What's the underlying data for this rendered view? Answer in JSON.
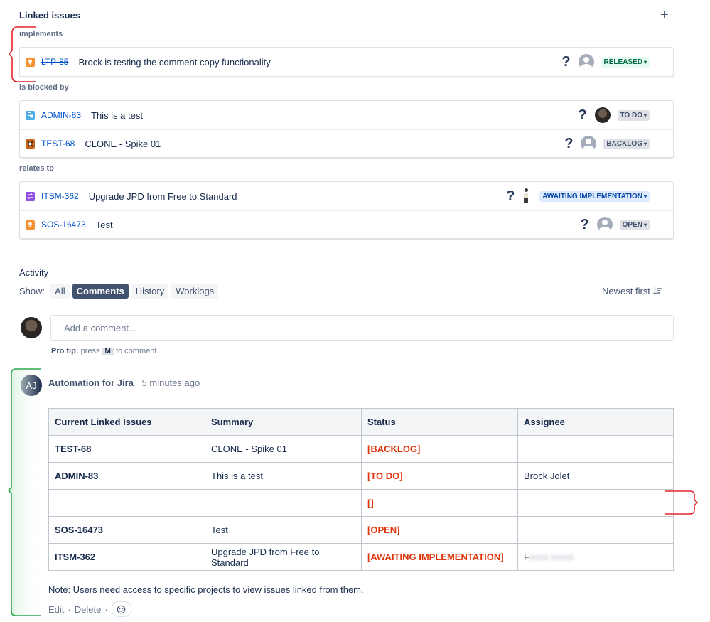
{
  "linked": {
    "title": "Linked issues",
    "groups": [
      {
        "label": "implements",
        "items": [
          {
            "key": "LTP-85",
            "summary": "Brock is testing the comment copy functionality",
            "status": "RELEASED"
          }
        ]
      },
      {
        "label": "is blocked by",
        "items": [
          {
            "key": "ADMIN-83",
            "summary": "This is a test",
            "status": "TO DO"
          },
          {
            "key": "TEST-68",
            "summary": "CLONE - Spike 01",
            "status": "BACKLOG"
          }
        ]
      },
      {
        "label": "relates to",
        "items": [
          {
            "key": "ITSM-362",
            "summary": "Upgrade JPD from Free to Standard",
            "status": "AWAITING IMPLEMENTATION"
          },
          {
            "key": "SOS-16473",
            "summary": "Test",
            "status": "OPEN"
          }
        ]
      }
    ],
    "priority_glyph": "?"
  },
  "activity": {
    "title": "Activity",
    "show_label": "Show:",
    "filters": [
      "All",
      "Comments",
      "History",
      "Worklogs"
    ],
    "active_filter": "Comments",
    "sort_label": "Newest first",
    "comment_placeholder": "Add a comment...",
    "protip": {
      "lead": "Pro tip:",
      "pre": "press",
      "key": "M",
      "post": "to comment"
    }
  },
  "comment": {
    "avatar_initials": "AJ",
    "author": "Automation for Jira",
    "time": "5 minutes ago",
    "table": {
      "headers": [
        "Current Linked Issues",
        "Summary",
        "Status",
        "Assignee"
      ],
      "rows": [
        [
          "TEST-68",
          "CLONE - Spike 01",
          "[BACKLOG]",
          ""
        ],
        [
          "ADMIN-83",
          "This is a test",
          "[TO DO]",
          "Brock Jolet"
        ],
        [
          "",
          "",
          "[]",
          ""
        ],
        [
          "SOS-16473",
          "Test",
          "[OPEN]",
          ""
        ],
        [
          "ITSM-362",
          "Upgrade JPD from Free to Standard",
          "[AWAITING IMPLEMENTATION]",
          "F"
        ]
      ]
    },
    "note": "Note: Users need access to specific projects to view issues linked from them.",
    "actions": {
      "edit": "Edit",
      "sep": "·",
      "delete": "Delete"
    }
  },
  "colors": {
    "accent": "#0052cc",
    "status_red": "#de350b",
    "annotation_red": "#e5252a",
    "annotation_green": "#2da84f"
  }
}
